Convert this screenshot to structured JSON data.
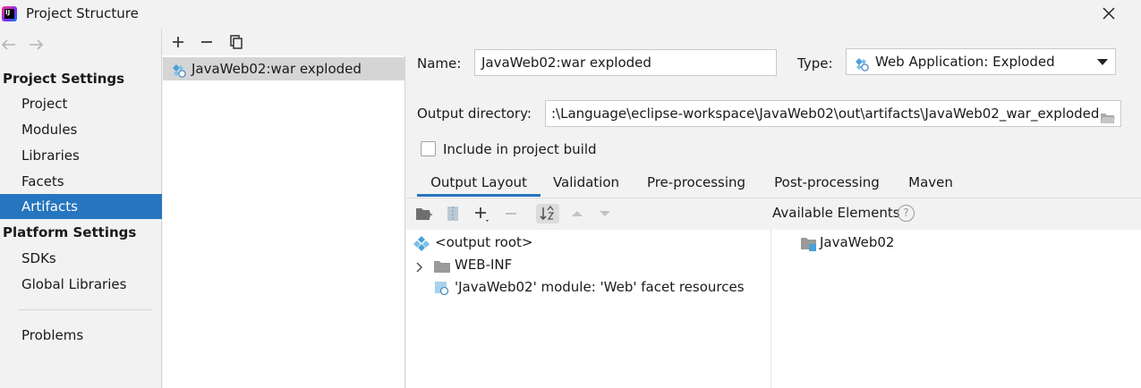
{
  "window": {
    "title": "Project Structure"
  },
  "sidebar": {
    "project_settings_header": "Project Settings",
    "project_settings_items": [
      "Project",
      "Modules",
      "Libraries",
      "Facets",
      "Artifacts"
    ],
    "platform_settings_header": "Platform Settings",
    "platform_settings_items": [
      "SDKs",
      "Global Libraries"
    ],
    "other_items": [
      "Problems"
    ],
    "selected": "Artifacts"
  },
  "artifacts_list": {
    "items": [
      "JavaWeb02:war exploded"
    ]
  },
  "form": {
    "name_label": "Name:",
    "name_value": "JavaWeb02:war exploded",
    "type_label": "Type:",
    "type_value": "Web Application: Exploded",
    "output_dir_label": "Output directory:",
    "output_dir_value": ":\\Language\\eclipse-workspace\\JavaWeb02\\out\\artifacts\\JavaWeb02_war_exploded",
    "include_build_label": "Include in project build",
    "include_build_checked": false
  },
  "tabs": [
    "Output Layout",
    "Validation",
    "Pre-processing",
    "Post-processing",
    "Maven"
  ],
  "active_tab": "Output Layout",
  "output_tree": {
    "root": "<output root>",
    "children": [
      "WEB-INF",
      "'JavaWeb02' module: 'Web' facet resources"
    ]
  },
  "available": {
    "label": "Available Elements",
    "items": [
      "JavaWeb02"
    ]
  },
  "colors": {
    "accent": "#2675bf",
    "selection_gray": "#d5d5d5",
    "background": "#f2f2f2"
  }
}
